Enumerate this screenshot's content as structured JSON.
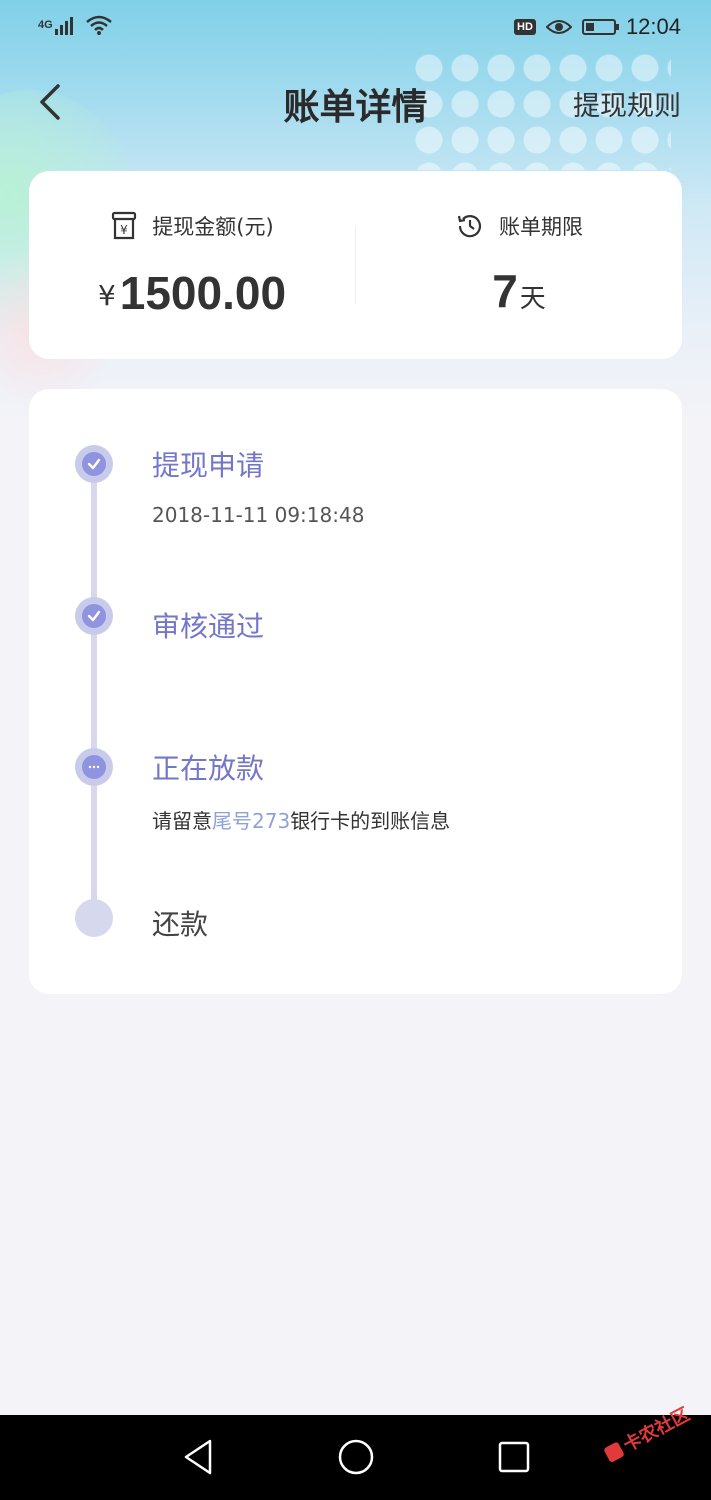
{
  "status_bar": {
    "network": "4G",
    "hd_badge": "HD",
    "time": "12:04",
    "battery_level_percent": 30
  },
  "header": {
    "title": "账单详情",
    "rules_link": "提现规则"
  },
  "summary": {
    "amount_label": "提现金额(元)",
    "currency_symbol": "¥",
    "amount": "1500.00",
    "period_label": "账单期限",
    "period_value": "7",
    "period_unit": "天"
  },
  "timeline": {
    "steps": [
      {
        "title": "提现申请",
        "subtitle": "2018-11-11 09:18:48",
        "status": "done"
      },
      {
        "title": "审核通过",
        "status": "done"
      },
      {
        "title": "正在放款",
        "subtitle_prefix": "请留意",
        "subtitle_highlight": "尾号273",
        "subtitle_suffix": "银行卡的到账信息",
        "status": "in-progress"
      },
      {
        "title": "还款",
        "status": "pending"
      }
    ]
  },
  "colors": {
    "accent": "#8f93e0",
    "accent_text": "#7376c9",
    "highlight_text": "#8fa2d8",
    "timeline_line": "#d7d8ec"
  },
  "watermark_text": "卡农社区"
}
